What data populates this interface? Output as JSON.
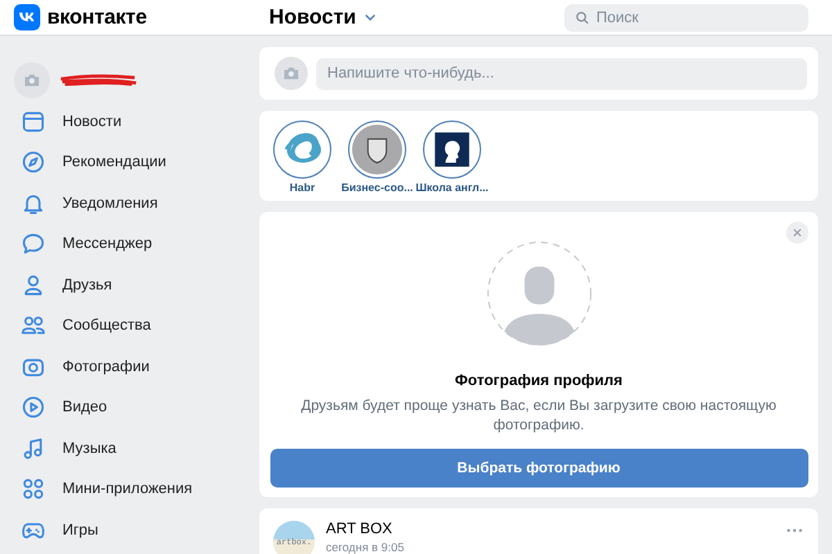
{
  "header": {
    "logo_text": "вконтакте",
    "page_title": "Новости",
    "search": {
      "placeholder": "Поиск"
    }
  },
  "sidebar": {
    "items": [
      {
        "label": "Новости"
      },
      {
        "label": "Рекомендации"
      },
      {
        "label": "Уведомления"
      },
      {
        "label": "Мессенджер"
      },
      {
        "label": "Друзья"
      },
      {
        "label": "Сообщества"
      },
      {
        "label": "Фотографии"
      },
      {
        "label": "Видео"
      },
      {
        "label": "Музыка"
      },
      {
        "label": "Мини-приложения"
      },
      {
        "label": "Игры"
      }
    ]
  },
  "composer": {
    "placeholder": "Напишите что-нибудь..."
  },
  "stories": [
    {
      "name": "Habr"
    },
    {
      "name": "Бизнес-соо..."
    },
    {
      "name": "Школа англ..."
    }
  ],
  "profile_photo_card": {
    "title": "Фотография профиля",
    "text": "Друзьям будет проще узнать Вас, если Вы загрузите свою настоящую фотографию.",
    "button": "Выбрать фотографию"
  },
  "post": {
    "author": "ART BOX",
    "avatar_text": "artbox.",
    "time": "сегодня в 9:05"
  }
}
